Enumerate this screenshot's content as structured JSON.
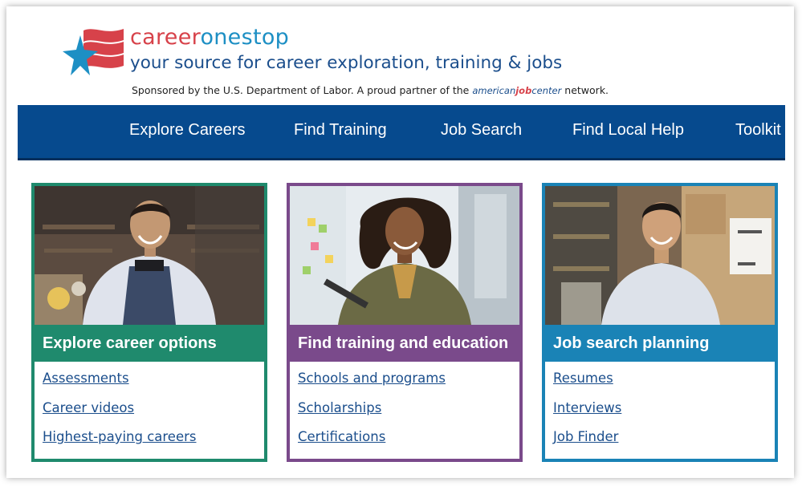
{
  "header": {
    "brand_part1": "career",
    "brand_part2": "onestop",
    "tagline": "your source for career exploration, training & jobs",
    "sponsor_text": "Sponsored by the U.S. Department of Labor. A proud partner of the",
    "partner_logo": {
      "part1": "american",
      "part2": "job",
      "part3": "center"
    },
    "sponsor_suffix": "network."
  },
  "nav": {
    "items": [
      {
        "label": "Explore Careers"
      },
      {
        "label": "Find Training"
      },
      {
        "label": "Job Search"
      },
      {
        "label": "Find Local Help"
      },
      {
        "label": "Toolkit"
      }
    ]
  },
  "cards": [
    {
      "title": "Explore career options",
      "links": [
        "Assessments",
        "Career videos",
        "Highest-paying careers"
      ]
    },
    {
      "title": "Find training and education",
      "links": [
        "Schools and programs",
        "Scholarships",
        "Certifications"
      ]
    },
    {
      "title": "Job search planning",
      "links": [
        "Resumes",
        "Interviews",
        "Job Finder"
      ]
    }
  ],
  "colors": {
    "nav": "#064a8e",
    "card_explore": "#1f8a6d",
    "card_training": "#7a4a8b",
    "card_jobs": "#1a83b6",
    "brand_red": "#d7424a",
    "brand_blue": "#1d8fc4"
  }
}
